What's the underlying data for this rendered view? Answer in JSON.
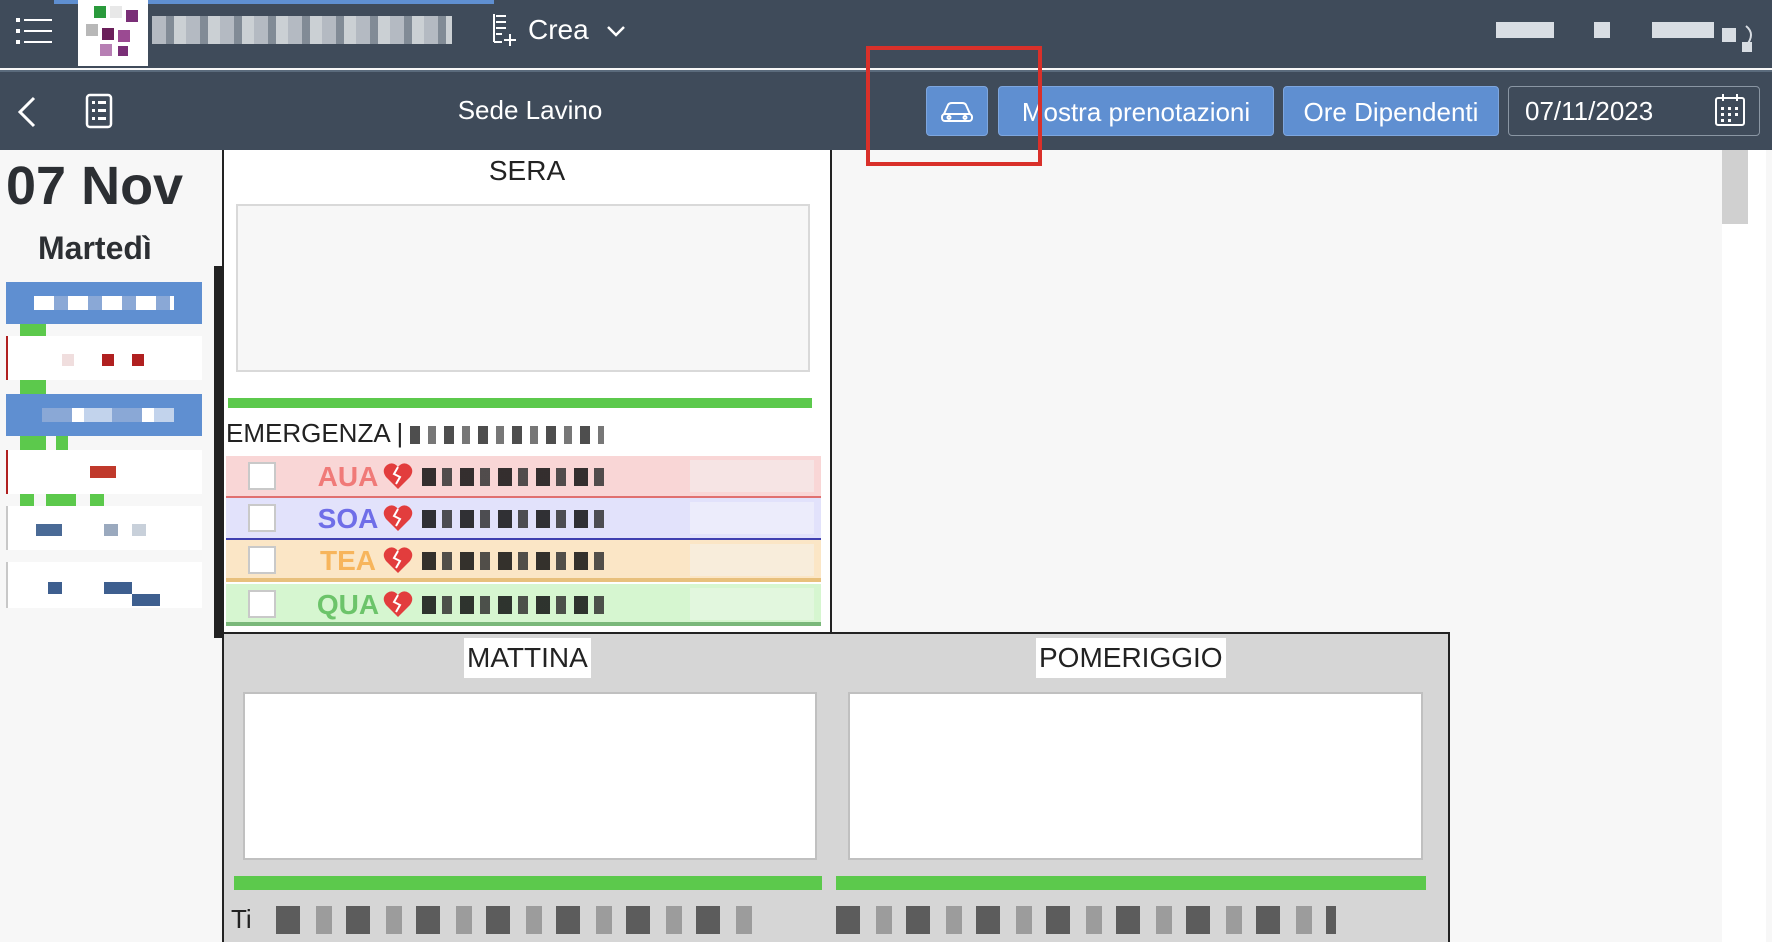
{
  "header": {
    "create_label": "Crea"
  },
  "toolbar": {
    "site_title": "Sede Lavino",
    "show_bookings_label": "Mostra prenotazioni",
    "employee_hours_label": "Ore Dipendenti",
    "date_value": "07/11/2023"
  },
  "day": {
    "date": "07 Nov",
    "weekday": "Martedì"
  },
  "panels": {
    "evening_title": "SERA",
    "emergency_label": "EMERGENZA |",
    "morning_title": "MATTINA",
    "afternoon_title": "POMERIGGIO",
    "bottom_prefix": "Ti"
  },
  "emergency_rows": [
    {
      "code": "AUA",
      "color": "#f07a78",
      "bg": "#f9d6d6"
    },
    {
      "code": "SOA",
      "color": "#6f6ee8",
      "bg": "#e2e2fb"
    },
    {
      "code": "TEA",
      "color": "#f7b55c",
      "bg": "#fbe6c6"
    },
    {
      "code": "QUA",
      "color": "#6cc46a",
      "bg": "#d6f6d0"
    }
  ],
  "colors": {
    "shell": "#3f4b5a",
    "accent_button": "#5f8fd1",
    "highlight": "#d9302a",
    "progress": "#5cc94c"
  }
}
